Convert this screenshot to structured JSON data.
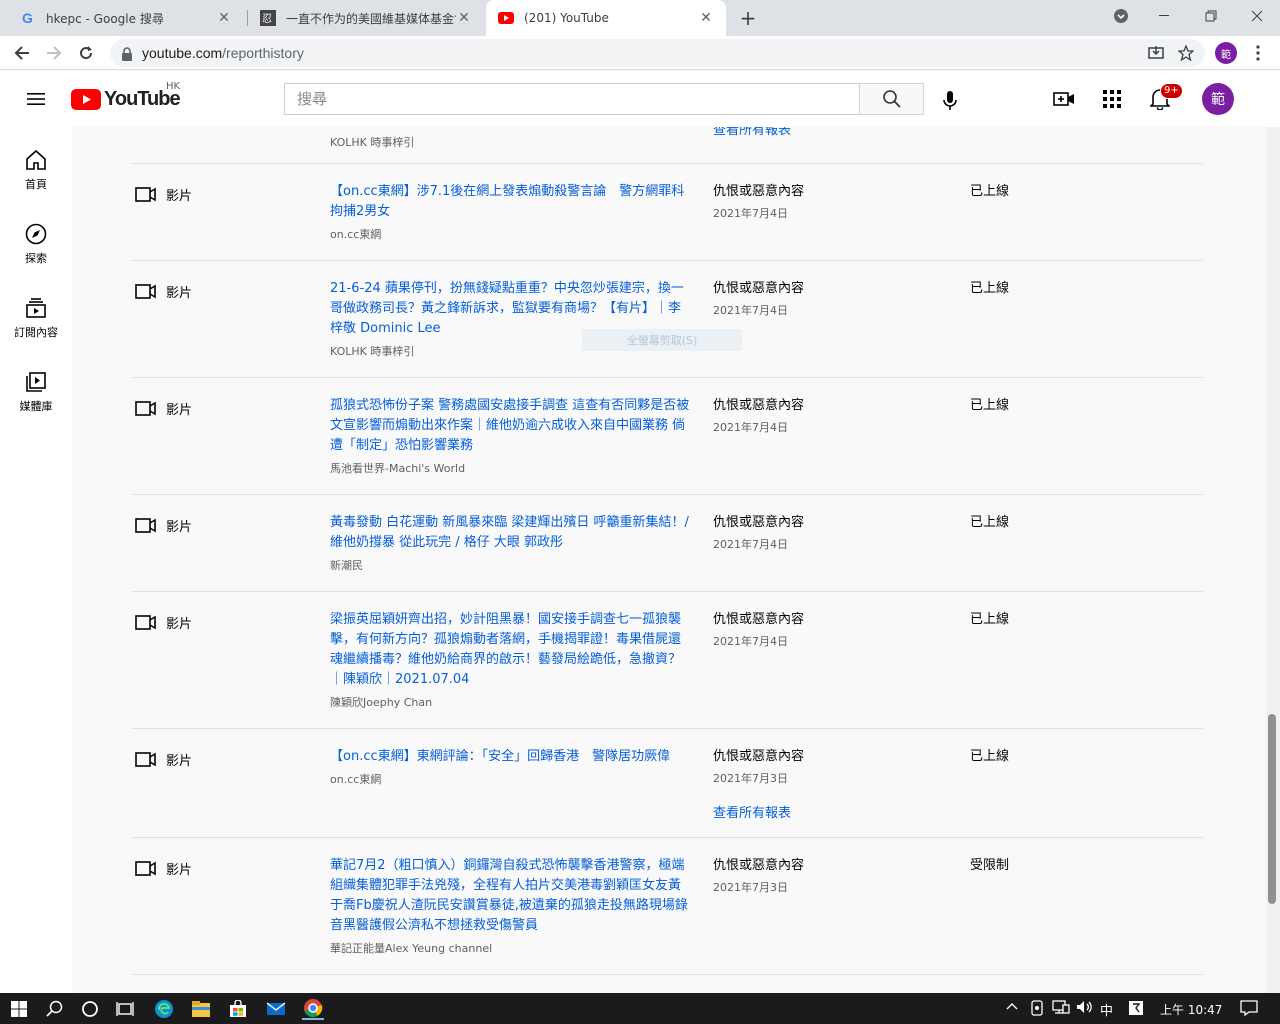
{
  "browser": {
    "tabs": [
      {
        "title": "hkepc - Google 搜尋",
        "favicon": "google-icon",
        "active": false
      },
      {
        "title": "一直不作为的美國維基媒体基金會",
        "favicon": "site-icon",
        "active": false
      },
      {
        "title": "(201) YouTube",
        "favicon": "youtube-icon",
        "active": true
      }
    ],
    "url_host": "youtube.com",
    "url_path": "/reporthistory"
  },
  "masthead": {
    "logo_text": "YouTube",
    "region": "HK",
    "search_placeholder": "搜尋",
    "notification_count": "9+",
    "avatar_initial": "範"
  },
  "guide": [
    {
      "label": "首頁",
      "icon": "home-icon"
    },
    {
      "label": "探索",
      "icon": "explore-icon"
    },
    {
      "label": "訂閱內容",
      "icon": "subscriptions-icon"
    },
    {
      "label": "媒體庫",
      "icon": "library-icon"
    }
  ],
  "partial_row": {
    "channel": "KOLHK 時事梓引",
    "view_all": "查看所有報表"
  },
  "reports": [
    {
      "type": "影片",
      "title": "【on.cc東網】涉7.1後在網上發表煽動殺警言論　警方網罪科拘捕2男女",
      "channel": "on.cc東網",
      "reason": "仇恨或惡意內容",
      "date": "2021年7月4日",
      "status": "已上線",
      "view_all": ""
    },
    {
      "type": "影片",
      "title": "21-6-24 蘋果停刊，扮無錢疑點重重？中央忽炒張建宗，換一哥做政務司長？黃之鋒新訴求，監獄要有商場？【有片】｜李梓敬 Dominic Lee",
      "channel": "KOLHK 時事梓引",
      "reason": "仇恨或惡意內容",
      "date": "2021年7月4日",
      "status": "已上線",
      "view_all": ""
    },
    {
      "type": "影片",
      "title": "孤狼式恐怖份子案 警務處國安處接手調查 這查有否同夥是否被文宣影響而煽動出來作案｜維他奶逾六成收入來自中國業務 倘遭「制定」恐怕影響業務",
      "channel": "馬池看世界-Machi's World",
      "reason": "仇恨或惡意內容",
      "date": "2021年7月4日",
      "status": "已上線",
      "view_all": ""
    },
    {
      "type": "影片",
      "title": "黃毒發動 白花運動 新風暴來臨 梁建輝出殯日 呼籲重新集結！/ 維他奶撐暴 從此玩完 / 格仔 大眼 郭政彤",
      "channel": "新潮民",
      "reason": "仇恨或惡意內容",
      "date": "2021年7月4日",
      "status": "已上線",
      "view_all": ""
    },
    {
      "type": "影片",
      "title": "梁振英屈穎妍齊出招，妙計阻黑暴！國安接手調查七一孤狼襲擊，有何新方向？孤狼煽動者落網，手機揭罪證！毒果借屍還魂繼續播毒？維他奶給商界的啟示！藝發局絵跪低，急撤資？｜陳穎欣｜2021.07.04",
      "channel": "陳穎欣Joephy Chan",
      "reason": "仇恨或惡意內容",
      "date": "2021年7月4日",
      "status": "已上線",
      "view_all": ""
    },
    {
      "type": "影片",
      "title": "【on.cc東網】東網評論：「安全」回歸香港　警隊居功厥偉",
      "channel": "on.cc東網",
      "reason": "仇恨或惡意內容",
      "date": "2021年7月3日",
      "status": "已上線",
      "view_all": "查看所有報表"
    },
    {
      "type": "影片",
      "title": "華記7月2（粗口慎入）銅鑼灣自殺式恐怖襲擊香港警察，極端組織集體犯罪手法兇殘，全程有人拍片交美港毒劉穎匡女友黃于喬Fb慶祝人渣阮民安讚賞暴徒,被遺棄的孤狼走投無路現場錄音黑醫護假公濟私不想拯救受傷警員",
      "channel": "華記正能量Alex Yeung channel",
      "reason": "仇恨或惡意內容",
      "date": "2021年7月3日",
      "status": "受限制",
      "view_all": ""
    }
  ],
  "overlay_hint": "全螢幕剪取(S)",
  "taskbar": {
    "ime": "中",
    "clock": "上午 10:47"
  }
}
